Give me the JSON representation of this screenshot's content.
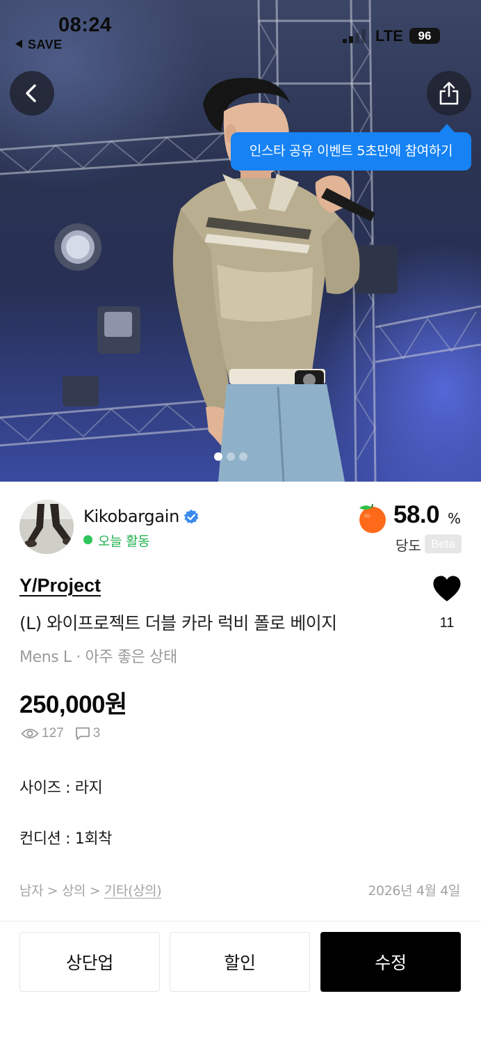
{
  "status_bar": {
    "time": "08:24",
    "back_app": "SAVE",
    "network": "LTE",
    "battery": "96"
  },
  "hero": {
    "tooltip": "인스타 공유 이벤트 5초만에 참여하기",
    "image_count": 3,
    "current_image": 1
  },
  "seller": {
    "name": "Kikobargain",
    "activity": "오늘 활동",
    "sweetness_value": "58.0",
    "sweetness_unit": "%",
    "sweetness_label": "당도",
    "beta_badge": "Beta"
  },
  "product": {
    "brand": "Y/Project",
    "title": "(L) 와이프로젝트 더블 카라 럭비 폴로 베이지",
    "meta": "Mens L · 아주 좋은 상태",
    "price": "250,000원",
    "likes": "11",
    "views": "127",
    "chats": "3",
    "description": [
      "사이즈 : 라지",
      "컨디션 : 1회착"
    ],
    "category_path": "남자 > 상의 > ",
    "category_leaf": "기타(상의)",
    "date": "2026년 4월 4일"
  },
  "actions": {
    "bump": "상단업",
    "discount": "할인",
    "edit": "수정"
  },
  "colors": {
    "tooltip_blue": "#1682f3",
    "active_green": "#21b14f",
    "primary_button": "#000000"
  }
}
